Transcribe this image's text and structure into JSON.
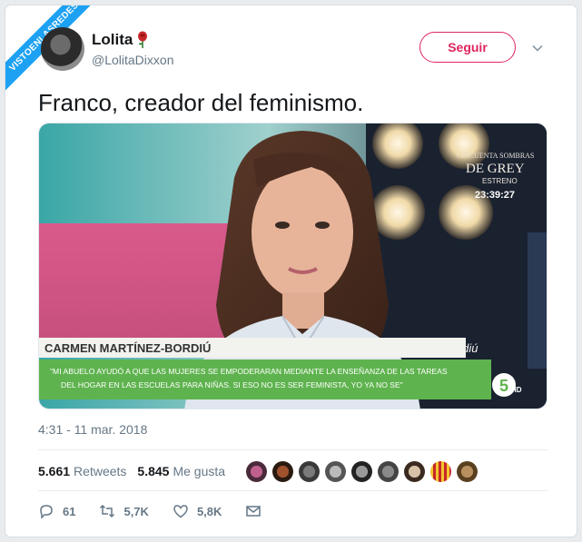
{
  "watermark": {
    "text": "VISTOENLASREDES"
  },
  "user": {
    "name": "Lolita",
    "handle": "@LolitaDixxon"
  },
  "follow_label": "Seguir",
  "tweet_text": "Franco, creador del feminismo.",
  "media": {
    "tv_badge_line1": "CINCUENTA SOMBRAS",
    "tv_badge_line2": "DE GREY",
    "tv_badge_line3": "ESTRENO",
    "tv_time": "23:39:27",
    "lower_third_name": "CARMEN MARTÍNEZ-BORDIÚ",
    "hashtag": "#labordiú",
    "quote_line1": "\"MI ABUELO AYUDÓ A QUE LAS MUJERES SE EMPODERARAN MEDIANTE LA ENSEÑANZA DE LAS TAREAS",
    "quote_line2": "DEL HOGAR EN LAS ESCUELAS PARA NIÑAS. SI ESO NO ES SER FEMINISTA, YO YA NO SE\"",
    "channel_logo": "5",
    "channel_hd": "HD"
  },
  "timestamp": "4:31 - 11 mar. 2018",
  "stats": {
    "retweets_count": "5.661",
    "retweets_label": "Retweets",
    "likes_count": "5.845",
    "likes_label": "Me gusta"
  },
  "actions": {
    "replies": "61",
    "retweets": "5,7K",
    "likes": "5,8K"
  },
  "colors": {
    "accent": "#1da1f2",
    "follow": "#e0245e",
    "muted": "#657786"
  }
}
